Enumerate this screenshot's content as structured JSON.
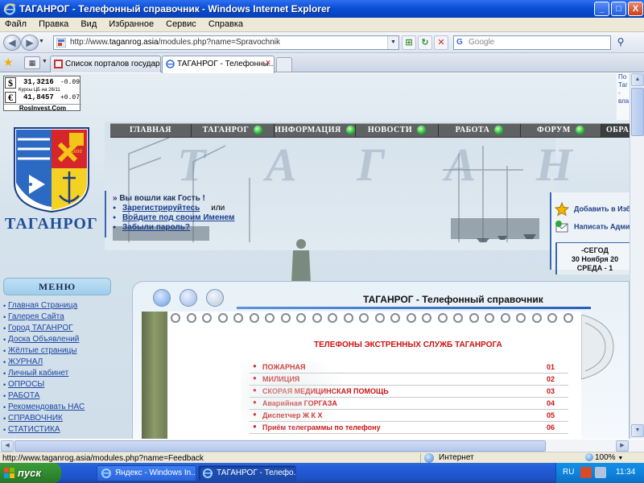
{
  "window": {
    "title": "ТАГАНРОГ - Телефонный справочник - Windows Internet Explorer",
    "minimize": "_",
    "maximize": "□",
    "close": "X"
  },
  "menubar": [
    "Файл",
    "Правка",
    "Вид",
    "Избранное",
    "Сервис",
    "Справка"
  ],
  "address": {
    "prefix": "http://www.",
    "domain": "taganrog.asia",
    "path": "/modules.php?name=Spravochnik"
  },
  "search": {
    "placeholder": "Google"
  },
  "tabs": [
    {
      "label": "Список порталов государс...",
      "active": false
    },
    {
      "label": "ТАГАНРОГ - Телефонны...",
      "active": true
    }
  ],
  "rates": {
    "usd_symbol": "$",
    "usd_value": "31,3216",
    "usd_delta": "-0.09",
    "cb_label": "Курсы ЦБ на",
    "cb_date": "26/11",
    "eur_symbol": "€",
    "eur_value": "41,8457",
    "eur_delta": "+0.07",
    "brand": "RosInvest.Com"
  },
  "header": {
    "city_name": "ТАГАНРОГ",
    "big_letters": "Т А Г А Н Р О Г",
    "arms_year": "1698"
  },
  "nav": [
    {
      "label": "ГЛАВНАЯ",
      "gem": false
    },
    {
      "label": "ТАГАНРОГ",
      "gem": true
    },
    {
      "label": "ИНФОРМАЦИЯ",
      "gem": true
    },
    {
      "label": "НОВОСТИ",
      "gem": true
    },
    {
      "label": "РАБОТА",
      "gem": true
    },
    {
      "label": "ФОРУМ",
      "gem": true
    },
    {
      "label": "ОБРА",
      "gem": false
    }
  ],
  "login": {
    "hello": "» Вы вошли как Гость !",
    "register": "Зарегистрируйтесь",
    "or": "или",
    "signin": "Войдите под своим Именем",
    "forgot": "Забыли пароль?"
  },
  "right_widgets": {
    "add_favorites": "Добавить в Избр",
    "write_admin": "Написать Админ"
  },
  "date_box": {
    "line1": "-СЕГОД",
    "line2": "30 Ноября 20",
    "line3": "СРЕДА - 1"
  },
  "top_right_clip": {
    "line1": "По",
    "line2": "Таг",
    "line3": "-",
    "line4": "вла"
  },
  "menu": {
    "title": "МЕНЮ",
    "items": [
      "Главная Страница",
      "Галерея Сайта",
      "Город ТАГАНРОГ",
      "Доска Объявлений",
      "Жёлтые страницы",
      "ЖУРНАЛ",
      "Личный кабинет",
      "ОПРОСЫ",
      "РАБОТА",
      "Рекомендовать НАС",
      "СПРАВОЧНИК",
      "СТАТИСТИКА"
    ]
  },
  "main": {
    "title": "ТАГАНРОГ - Телефонный справочник",
    "section_title": "ТЕЛЕФОНЫ ЭКСТРЕННЫХ СЛУЖБ ТАГАНРОГА",
    "phones": [
      {
        "name": "ПОЖАРНАЯ",
        "number": "01"
      },
      {
        "name": "МИЛИЦИЯ",
        "number": "02"
      },
      {
        "name": "СКОРАЯ МЕДИЦИНСКАЯ ПОМОЩЬ",
        "number": "03"
      },
      {
        "name": "Аварийная ГОРГАЗА",
        "number": "04"
      },
      {
        "name": "Диспетчер  Ж К Х",
        "number": "05"
      },
      {
        "name": "Приём телеграммы по телефону",
        "number": "06"
      }
    ]
  },
  "statusbar": {
    "url": "http://www.taganrog.asia/modules.php?name=Feedback",
    "zone": "Интернет",
    "zoom": "100%"
  },
  "taskbar": {
    "start": "пуск",
    "tasks": [
      {
        "label": "Яндекс - Windows In...",
        "active": false
      },
      {
        "label": "ТАГАНРОГ - Телефо...",
        "active": true
      }
    ],
    "lang": "RU",
    "clock": "11:34"
  }
}
